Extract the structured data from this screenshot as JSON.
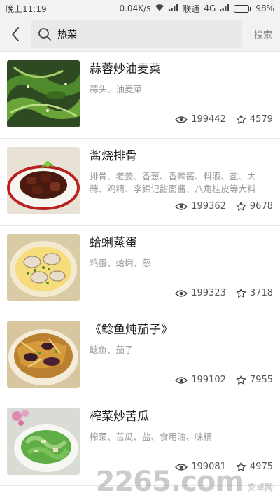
{
  "status_bar": {
    "time": "晚上11:19",
    "network_speed": "0.04K/s",
    "carrier": "联通",
    "network_type": "4G",
    "battery": "98%",
    "battery_level": 0.98
  },
  "search": {
    "query": "热菜",
    "button_label": "搜索"
  },
  "recipes": [
    {
      "title": "蒜蓉炒油麦菜",
      "ingredients": "蒜头、油麦菜",
      "views": "199442",
      "favorites": "4579"
    },
    {
      "title": "酱烧排骨",
      "ingredients": "排骨、老姜、香葱、香辣酱、料酒、盐、大蒜、鸡精、李锦记甜面酱、八角桂皮等大料",
      "views": "199362",
      "favorites": "9678"
    },
    {
      "title": "蛤蜊蒸蛋",
      "ingredients": "鸡蛋、蛤蜊、葱",
      "views": "199323",
      "favorites": "3718"
    },
    {
      "title": "《鲶鱼炖茄子》",
      "ingredients": "鲶鱼、茄子",
      "views": "199102",
      "favorites": "7955"
    },
    {
      "title": "榨菜炒苦瓜",
      "ingredients": "榨菜、苦瓜、盐、食用油、味精",
      "views": "199081",
      "favorites": "4975"
    }
  ],
  "watermark": {
    "brand": "2265",
    "domain_text": ".com",
    "site_name": "安卓网"
  },
  "colors": {
    "battery_green": "#35c04a",
    "header_bg": "#f2f2f2",
    "title_text": "#222222",
    "ingredient_text": "#999999"
  },
  "icons": {
    "back": "chevron-left-icon",
    "search": "magnifier-icon",
    "views": "eye-icon",
    "favorites": "star-icon",
    "wifi": "wifi-icon",
    "signal": "signal-bars-icon",
    "battery": "battery-icon"
  }
}
